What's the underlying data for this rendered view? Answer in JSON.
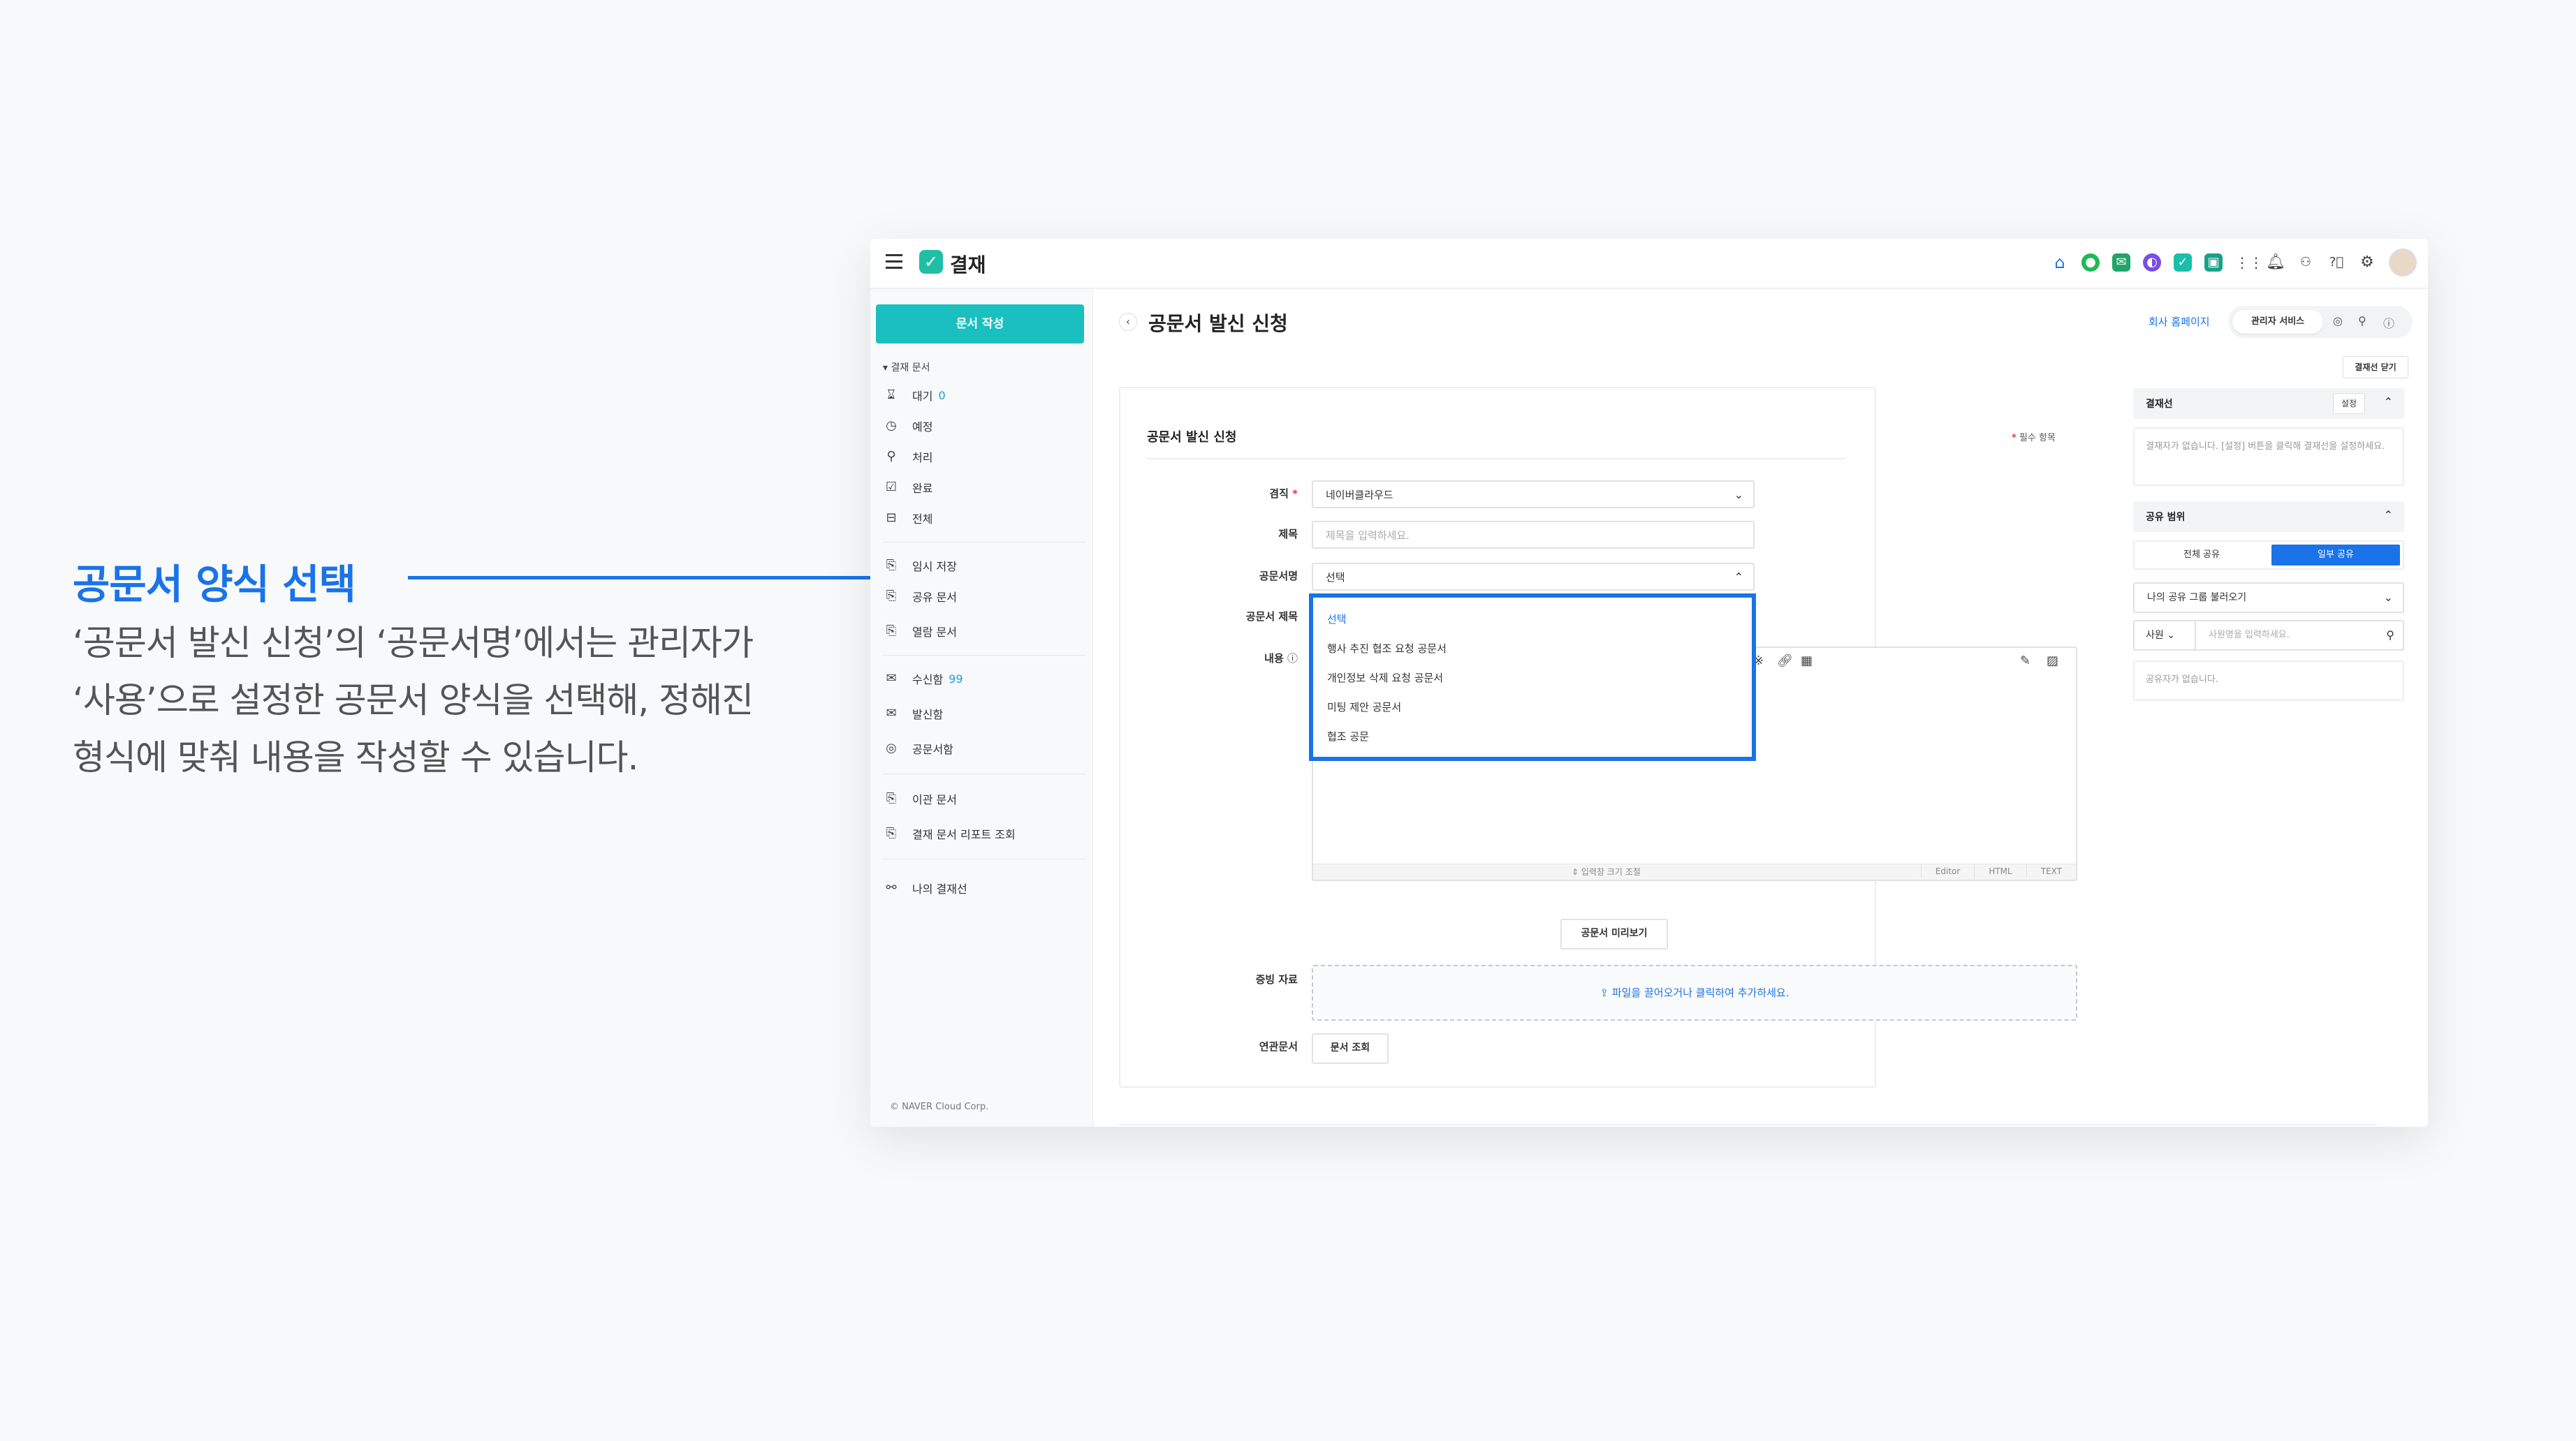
{
  "annotation": {
    "title": "공문서 양식 선택",
    "description": "‘공문서 발신 신청’의 ‘공문서명’에서는 관리자가\n‘사용’으로 설정한 공문서 양식을 선택해, 정해진\n형식에 맞춰 내용을 작성할 수 있습니다."
  },
  "topbar": {
    "app_name": "결재",
    "icons": [
      "home-icon",
      "chat-icon",
      "mail-icon",
      "calendar-icon",
      "approval-icon",
      "drive-icon",
      "apps-grid-icon",
      "bell-icon",
      "org-chart-icon",
      "help-icon",
      "settings-icon",
      "avatar"
    ]
  },
  "sidebar": {
    "new_doc_label": "문서 작성",
    "group_label": "결재 문서",
    "items": [
      {
        "label": "대기",
        "count": "0",
        "icon": "hourglass-icon"
      },
      {
        "label": "예정",
        "icon": "clock-icon"
      },
      {
        "label": "처리",
        "icon": "stamp-icon"
      },
      {
        "label": "완료",
        "icon": "check-doc-icon"
      },
      {
        "label": "전체",
        "icon": "inbox-icon"
      },
      {
        "label": "임시 저장",
        "icon": "draft-icon"
      },
      {
        "label": "공유 문서",
        "icon": "shared-doc-icon"
      },
      {
        "label": "열람 문서",
        "icon": "read-doc-icon"
      },
      {
        "label": "수신함",
        "count": "99",
        "icon": "receive-mail-icon"
      },
      {
        "label": "발신함",
        "icon": "send-mail-icon"
      },
      {
        "label": "공문서함",
        "icon": "official-doc-icon"
      },
      {
        "label": "이관 문서",
        "icon": "transfer-doc-icon"
      },
      {
        "label": "결재 문서 리포트 조회",
        "icon": "report-icon"
      },
      {
        "label": "나의 결재선",
        "icon": "approval-line-icon"
      }
    ],
    "copyright": "© NAVER Cloud Corp."
  },
  "page": {
    "title": "공문서 발신 신청",
    "homepage_link": "회사 홈페이지",
    "admin_service": "관리자 서비스",
    "close_line": "결재선 닫기"
  },
  "form": {
    "title": "공문서 발신 신청",
    "required_note": "필수 항목",
    "required_mark": "*",
    "fields": {
      "job_label": "겸직",
      "job_value": "네이버클라우드",
      "subject_label": "제목",
      "subject_placeholder": "제목을 입력하세요.",
      "doc_name_label": "공문서명",
      "doc_name_value": "선택",
      "doc_title_label": "공문서 제목",
      "content_label": "내용",
      "evidence_label": "증빙 자료",
      "related_label": "연관문서"
    },
    "dropdown_options": [
      "선택",
      "행사 추진 협조 요청 공문서",
      "개인정보 삭제 요청 공문서",
      "미팅 제안 공문서",
      "협조 공문"
    ],
    "editor": {
      "resize_hint": "⇕ 입력창 크기 조절",
      "tabs": [
        "Editor",
        "HTML",
        "TEXT"
      ]
    },
    "preview_button": "공문서 미리보기",
    "dropzone_text": "파일을 끌어오거나 클릭하여 추가하세요.",
    "doc_search_button": "문서 조회"
  },
  "right_panel": {
    "approval_line_title": "결재선",
    "setting_btn": "설정",
    "approval_empty": "결재자가 없습니다. [설정] 버튼을 클릭해 결재선을 설정하세요.",
    "share_scope_title": "공유 범위",
    "share_all": "전체 공유",
    "share_partial": "일부 공유",
    "share_group_select": "나의 공유 그룹 불러오기",
    "search_type": "사원",
    "search_placeholder": "사원명을 입력하세요.",
    "sharer_empty": "공유자가 없습니다."
  },
  "colors": {
    "accent": "#1a73e8",
    "brand_teal": "#19c0bf",
    "required": "#e53935"
  }
}
